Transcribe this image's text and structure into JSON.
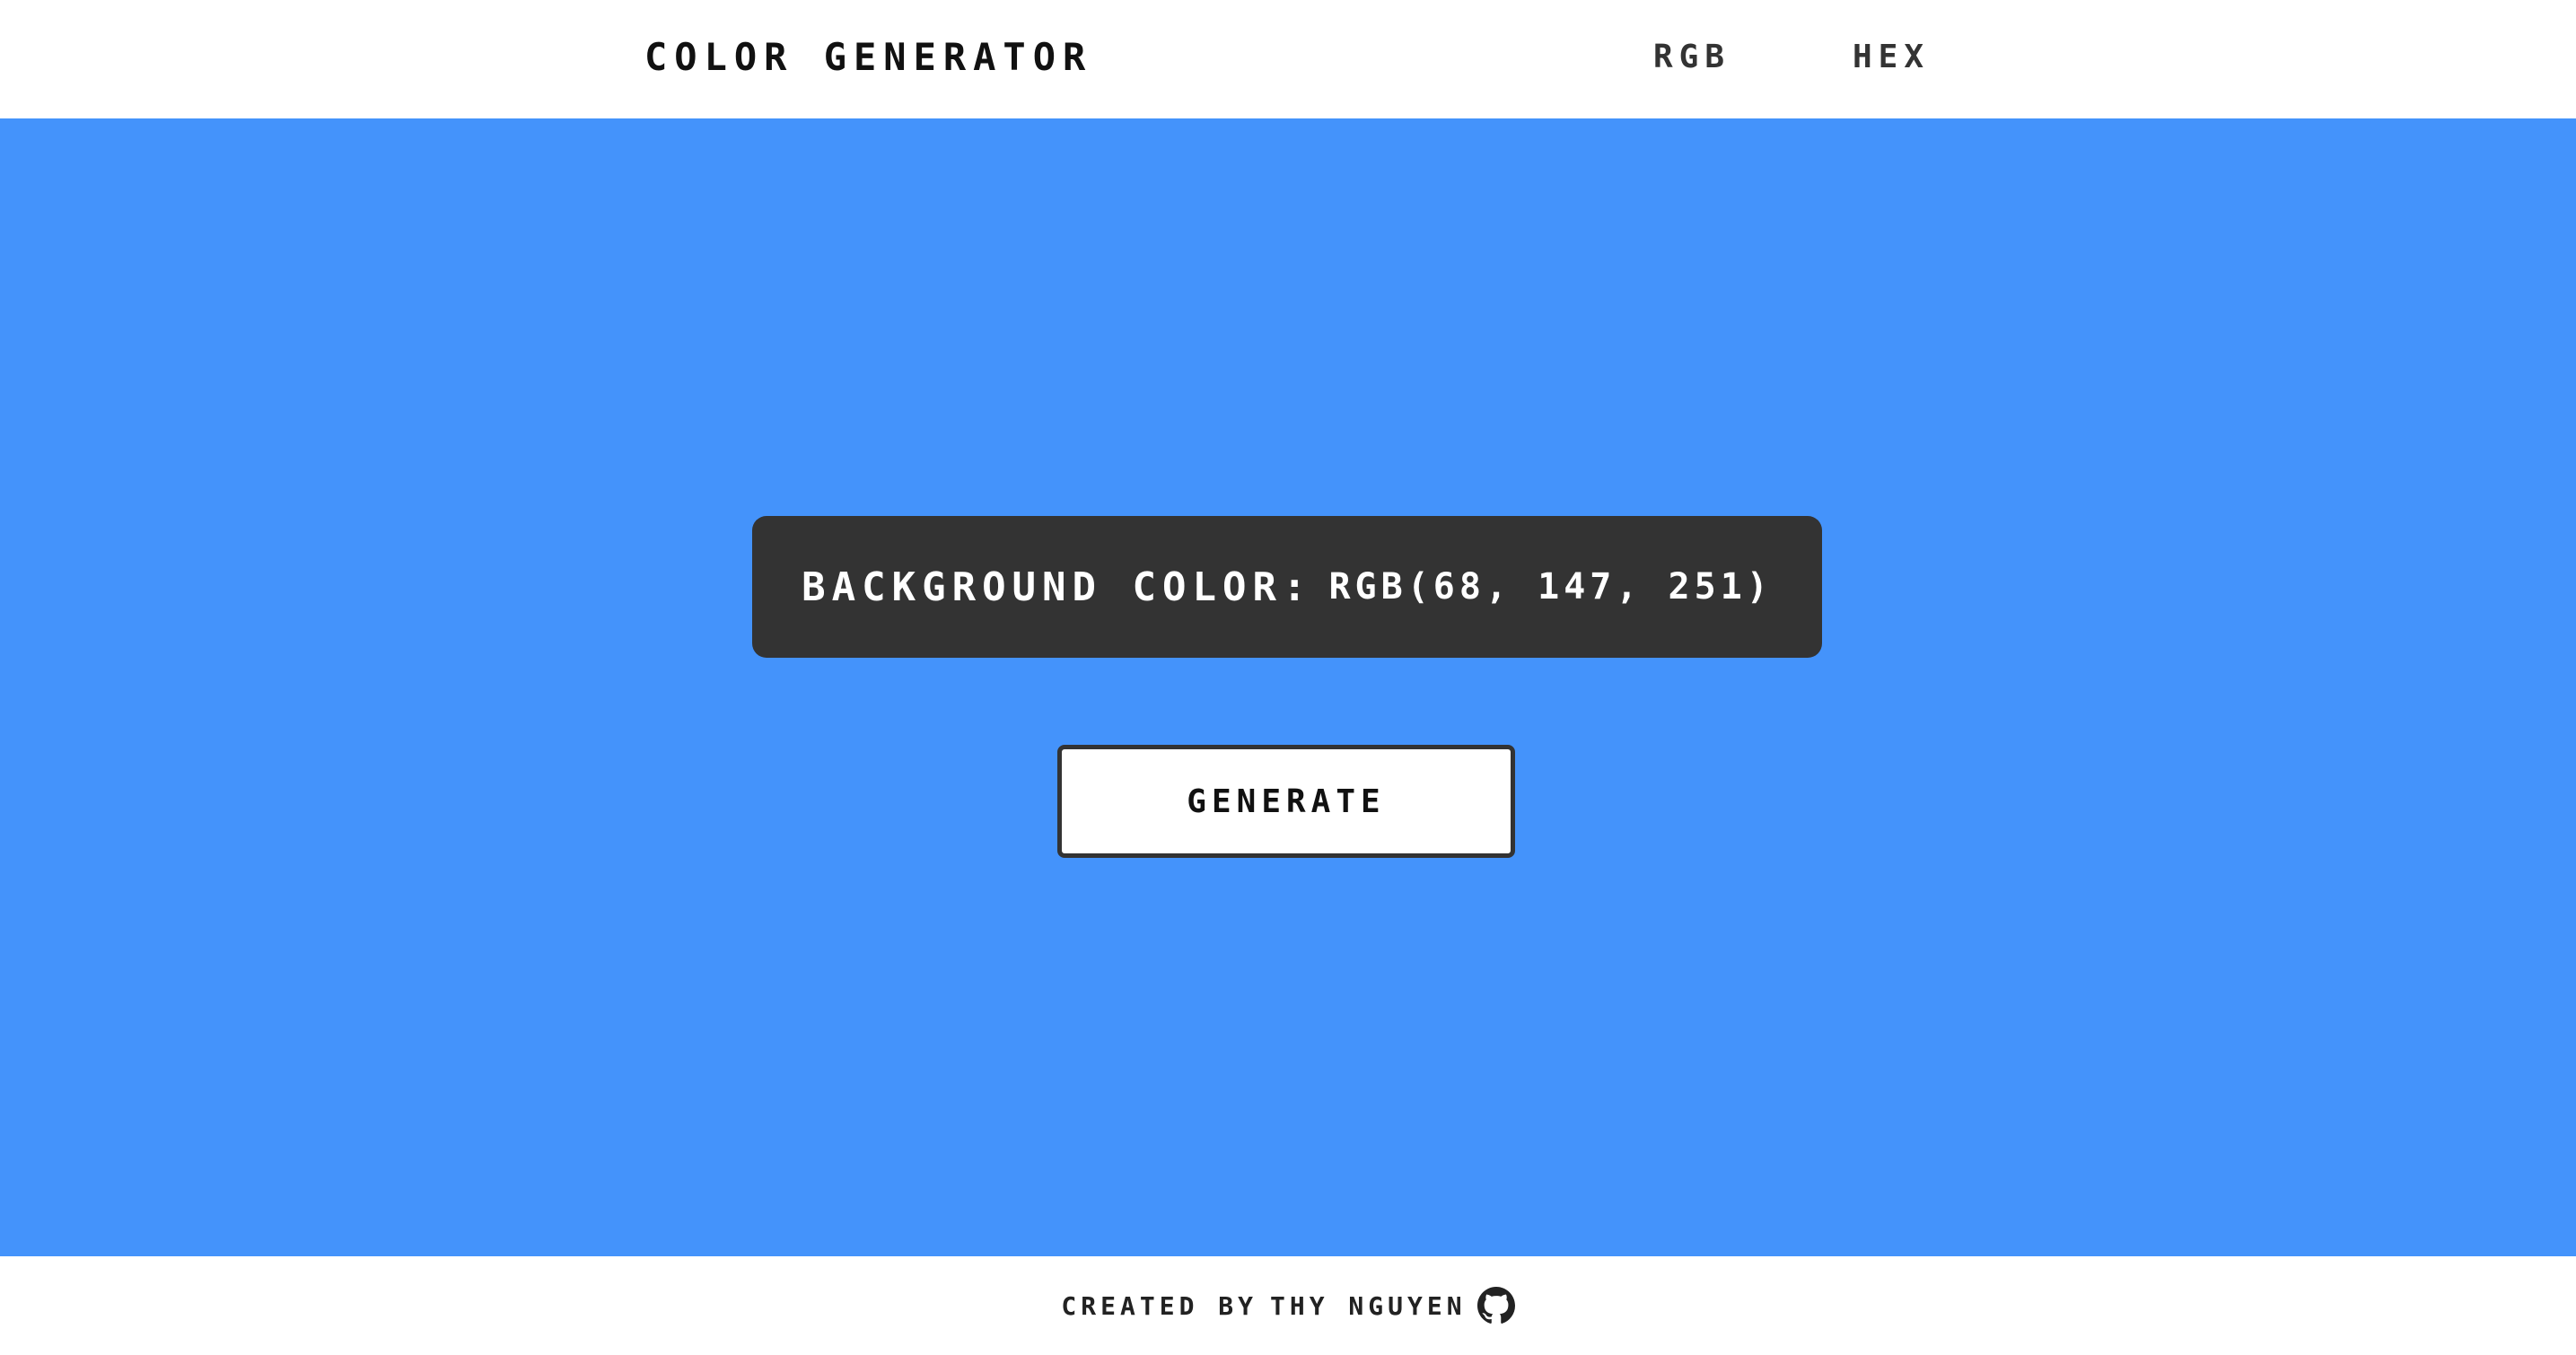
{
  "header": {
    "title": "COLOR GENERATOR",
    "nav": [
      {
        "label": "RGB"
      },
      {
        "label": "HEX"
      }
    ]
  },
  "main": {
    "background_color": "#4493fb",
    "color_label": "BACKGROUND COLOR:",
    "color_value": "RGB(68, 147, 251)",
    "generate_label": "GENERATE"
  },
  "footer": {
    "created_by": "CREATED BY",
    "author": "THY NGUYEN",
    "icon": "github-icon"
  }
}
